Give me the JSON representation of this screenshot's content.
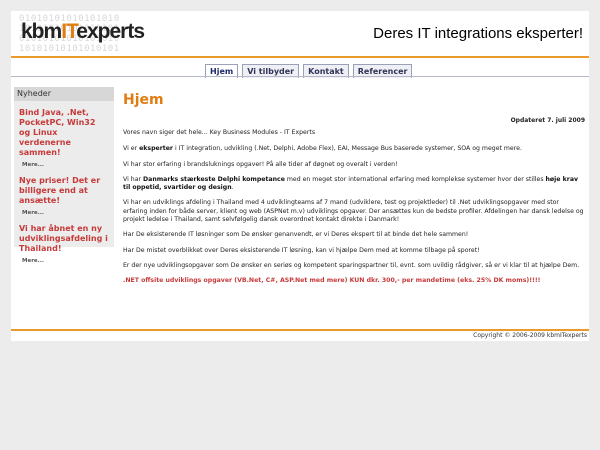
{
  "header": {
    "logo_prefix": "kbm",
    "logo_it": "IT",
    "logo_suffix": "experts",
    "tagline": "Deres IT integrations eksperter!",
    "colors": {
      "accent": "#e07c10",
      "rule": "#e89a2a",
      "news": "#c63a3a"
    }
  },
  "nav": {
    "tabs": [
      {
        "label": "Hjem"
      },
      {
        "label": "Vi tilbyder"
      },
      {
        "label": "Kontakt"
      },
      {
        "label": "Referencer"
      }
    ]
  },
  "sidebar": {
    "heading": "Nyheder",
    "items": [
      {
        "title": "Bind Java, .Net, PocketPC, Win32 og Linux verdenerne sammen!",
        "more": "Mere..."
      },
      {
        "title": "Nye priser! Det er billigere end at ansætte!",
        "more": "Mere..."
      },
      {
        "title": "Vi har åbnet en ny udviklingsafdeling i Thailand!",
        "more": "Mere..."
      }
    ]
  },
  "main": {
    "title": "Hjem",
    "updated": "Opdateret 7. juli 2009",
    "p1": "Vores navn siger det hele... Key Business Modules - IT Experts",
    "p2a": "Vi er ",
    "p2b": "eksperter",
    "p2c": " i IT integration, udvikling (.Net, Delphi, Adobe Flex), EAI, Message Bus baserede systemer, SOA og meget mere.",
    "p3": "Vi har stor erfaring i brandsluknings opgaver! På alle tider af døgnet og overalt i verden!",
    "p4a": "Vi har ",
    "p4b": "Danmarks stærkeste Delphi kompetance",
    "p4c": " med en meget stor international erfaring med komplekse systemer hvor der stilles ",
    "p4d": "høje krav til oppetid, svartider og design",
    "p4e": ".",
    "p5": "Vi har en udviklings afdeling i Thailand med 4 udviklingteams af 7 mand (udviklere, test og projektleder) til .Net udviklingsopgaver med stor erfaring inden for både server, klient og web (ASPNet m.v) udviklings opgaver. Der ansættes kun de bedste profiler. Afdelingen har dansk ledelse og projekt ledelse i Thailand, samt selvfølgelig dansk overordnet kontakt direkte i Danmark!",
    "p6": "Har De eksisterende IT løsninger som De ønsker genanvendt, er vi Deres ekspert til at binde det hele sammen!",
    "p7": "Har De mistet overblikket over Deres eksisterende IT løsning, kan vi hjælpe Dem med at komme tilbage på sporet!",
    "p8": "Er der nye udviklingsopgaver som De ønsker en seriøs og kompetent sparingspartner til, evnt. som uvildig rådgiver, så er vi klar til at hjælpe Dem.",
    "p9": ".NET offsite udviklings opgaver (VB.Net, C#, ASP.Net med mere) KUN dkr. 300,- per mandetime (eks. 25% DK moms)!!!!"
  },
  "footer": {
    "copyright": "Copyright © 2006-2009 kbmITexperts"
  }
}
